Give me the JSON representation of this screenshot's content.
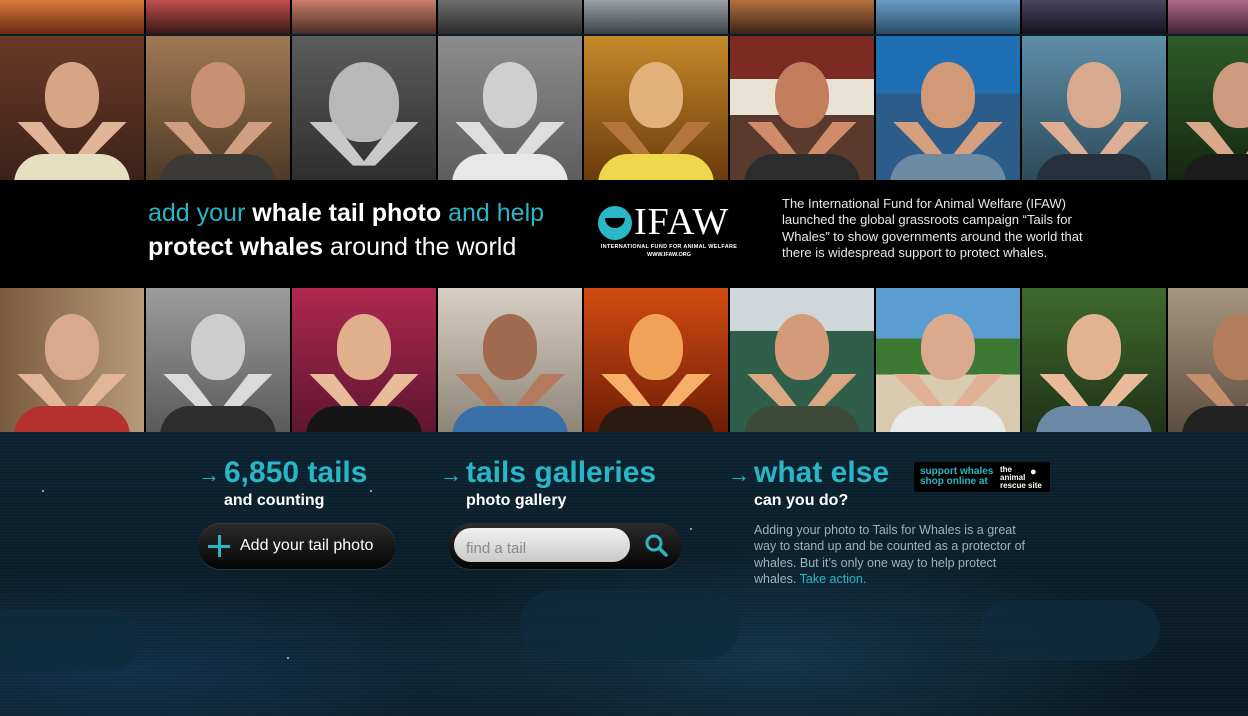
{
  "banner": {
    "headline_part1": "add your ",
    "headline_bold1": "whale tail photo",
    "headline_part2": " and help",
    "headline_bold2": "protect whales",
    "headline_part3": " around the world",
    "logo_word": "IFAW",
    "logo_sub": "INTERNATIONAL FUND FOR ANIMAL WELFARE",
    "logo_url": "WWW.IFAW.ORG",
    "intro": "The International Fund for Animal Welfare (IFAW) launched the global grassroots campaign “Tails for Whales” to show governments around the world that there is widespread support to protect whales."
  },
  "columns": {
    "tails": {
      "title": "6,850 tails",
      "subtitle": "and counting",
      "button_label": "Add your tail photo"
    },
    "galleries": {
      "title": "tails galleries",
      "subtitle": "photo gallery",
      "search_placeholder": "find a tail"
    },
    "what_else": {
      "title": "what else",
      "subtitle": "can you do?",
      "body": "Adding your photo to Tails for Whales is a great way to stand up and be counted as a protector of whales. But it’s only one way to help protect whales. ",
      "link": "Take action."
    }
  },
  "promo": {
    "line1": "support whales",
    "line2": "shop online at",
    "logo_line1": "the",
    "logo_line2": "animal",
    "logo_line3": "rescue site"
  },
  "icons": {
    "arrow": "arrow-right-icon",
    "plus": "plus-icon",
    "search": "search-icon",
    "paw": "paw-icon"
  },
  "colors": {
    "accent": "#29b7c7",
    "band": "#000000",
    "page_bg": "#0b1e2b"
  }
}
